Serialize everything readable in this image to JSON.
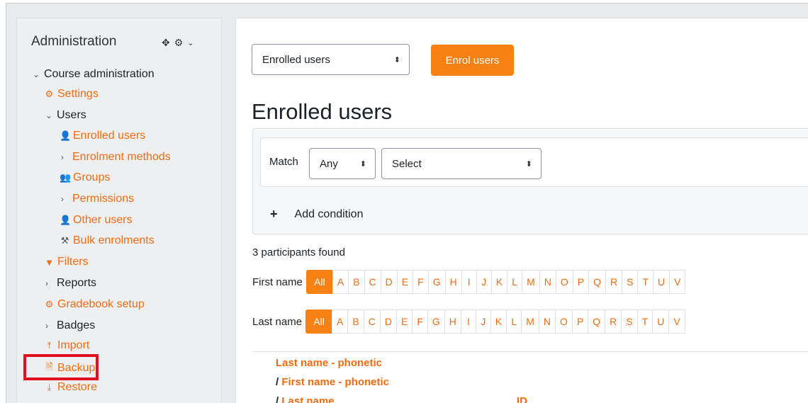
{
  "sidebar": {
    "title": "Administration",
    "controls": [
      "move-icon",
      "gear-icon",
      "chevron-down-icon"
    ],
    "items": [
      {
        "label": "Course administration",
        "icon": "chevron-down",
        "style": "plain"
      },
      {
        "label": "Settings",
        "icon": "gear",
        "style": "link"
      },
      {
        "label": "Users",
        "icon": "chevron-down",
        "style": "plain"
      },
      {
        "label": "Enrolled users",
        "icon": "user-plus",
        "style": "link"
      },
      {
        "label": "Enrolment methods",
        "icon": "chevron-right",
        "style": "link"
      },
      {
        "label": "Groups",
        "icon": "users",
        "style": "link"
      },
      {
        "label": "Permissions",
        "icon": "chevron-right",
        "style": "link"
      },
      {
        "label": "Other users",
        "icon": "user-plus",
        "style": "link"
      },
      {
        "label": "Bulk enrolments",
        "icon": "hammer",
        "style": "link"
      },
      {
        "label": "Filters",
        "icon": "filter",
        "style": "link"
      },
      {
        "label": "Reports",
        "icon": "chevron-right",
        "style": "plain"
      },
      {
        "label": "Gradebook setup",
        "icon": "gear",
        "style": "link"
      },
      {
        "label": "Badges",
        "icon": "chevron-right",
        "style": "plain"
      },
      {
        "label": "Import",
        "icon": "import",
        "style": "link"
      },
      {
        "label": "Backup",
        "icon": "file",
        "style": "link"
      },
      {
        "label": "Restore",
        "icon": "restore",
        "style": "link"
      }
    ]
  },
  "main": {
    "view_select": "Enrolled users",
    "enrol_button": "Enrol users",
    "title": "Enrolled users",
    "filter": {
      "match_label": "Match",
      "match_value": "Any",
      "select_value": "Select",
      "add_condition": "Add condition"
    },
    "participants_found": "3 participants found",
    "first_name_label": "First name",
    "last_name_label": "Last name",
    "initials": [
      "All",
      "A",
      "B",
      "C",
      "D",
      "E",
      "F",
      "G",
      "H",
      "I",
      "J",
      "K",
      "L",
      "M",
      "N",
      "O",
      "P",
      "Q",
      "R",
      "S",
      "T",
      "U",
      "V"
    ],
    "columns": {
      "last_phonetic": "Last name - phonetic",
      "slash": "/",
      "first_phonetic": "First name - phonetic",
      "last_name": "Last name",
      "id": "ID"
    }
  },
  "colors": {
    "accent": "#f98012",
    "link": "#f26b11",
    "highlight": "#e3101f"
  }
}
